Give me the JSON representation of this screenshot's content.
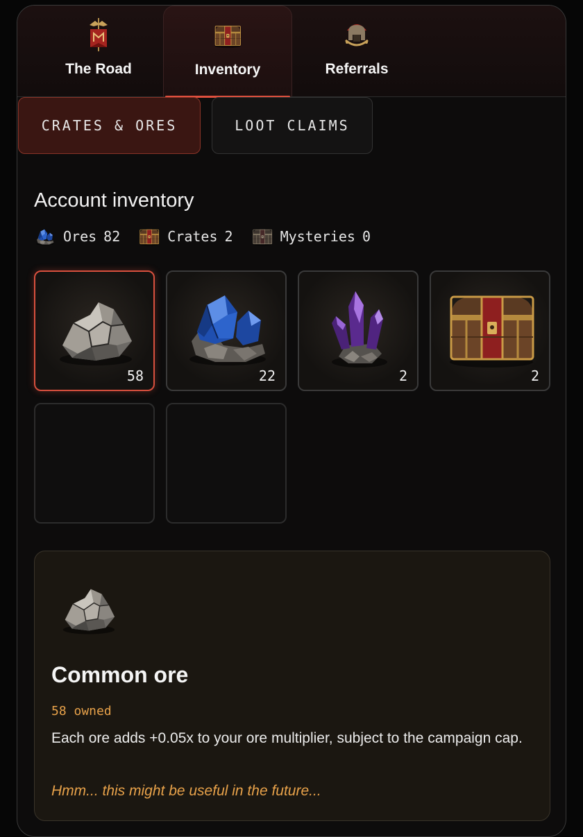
{
  "tabs": [
    {
      "label": "The Road",
      "icon": "banner-icon",
      "active": false
    },
    {
      "label": "Inventory",
      "icon": "chest-icon",
      "active": true
    },
    {
      "label": "Referrals",
      "icon": "helmet-icon",
      "active": false
    }
  ],
  "subtabs": [
    {
      "label": "CRATES & ORES",
      "active": true
    },
    {
      "label": "LOOT CLAIMS",
      "active": false
    }
  ],
  "inventory": {
    "heading": "Account inventory",
    "stats": [
      {
        "label": "Ores",
        "value": "82",
        "icon": "blue-ore-icon"
      },
      {
        "label": "Crates",
        "value": "2",
        "icon": "crate-icon"
      },
      {
        "label": "Mysteries",
        "value": "0",
        "icon": "mystery-crate-icon"
      }
    ],
    "slots": [
      {
        "item": "common-ore",
        "count": "58",
        "selected": true
      },
      {
        "item": "blue-ore",
        "count": "22",
        "selected": false
      },
      {
        "item": "purple-crystal",
        "count": "2",
        "selected": false
      },
      {
        "item": "crate",
        "count": "2",
        "selected": false
      },
      {
        "item": "empty",
        "count": "",
        "selected": false
      },
      {
        "item": "empty",
        "count": "",
        "selected": false
      }
    ]
  },
  "detail": {
    "name": "Common ore",
    "owned": "58 owned",
    "description": "Each ore adds +0.05x to your ore multiplier, subject to the campaign cap.",
    "flavor": "Hmm... this might be useful in the future..."
  },
  "colors": {
    "accent": "#e0503e",
    "gold": "#e8a24a",
    "background": "#0d0c0c"
  }
}
